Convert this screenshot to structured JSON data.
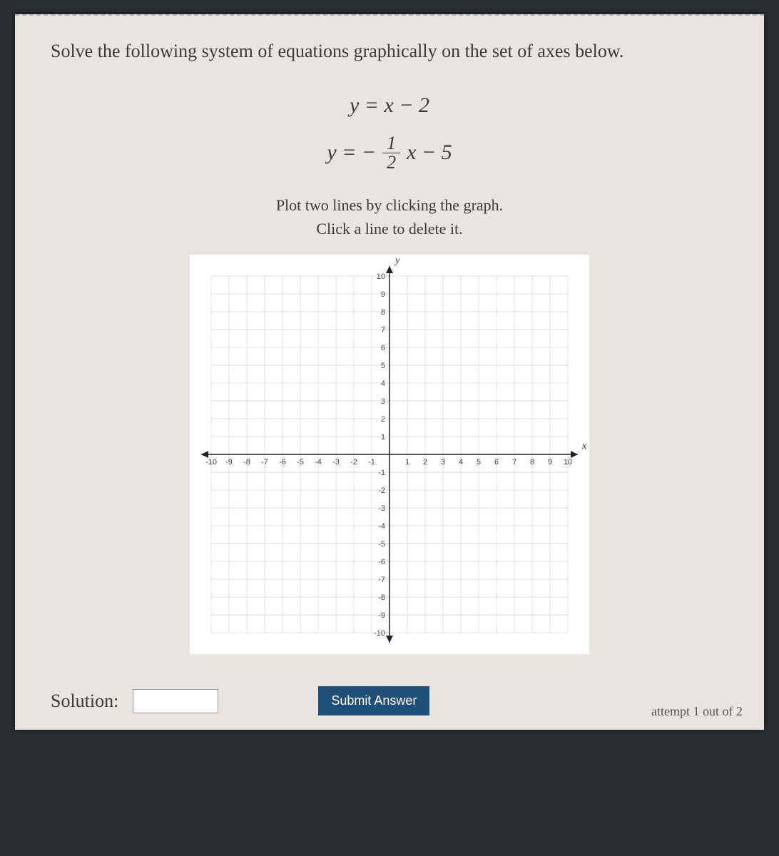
{
  "prompt": "Solve the following system of equations graphically on the set of axes below.",
  "eq1_text": "y = x − 2",
  "eq2_prefix": "y = −",
  "eq2_num": "1",
  "eq2_den": "2",
  "eq2_suffix": "x − 5",
  "instruction_line1": "Plot two lines by clicking the graph.",
  "instruction_line2": "Click a line to delete it.",
  "solution_label": "Solution:",
  "solution_value": "",
  "submit_label": "Submit Answer",
  "attempt_text": "attempt 1 out of 2",
  "chart_data": {
    "type": "line",
    "title": "",
    "xlabel": "x",
    "ylabel": "y",
    "xlim": [
      -10,
      10
    ],
    "ylim": [
      -10,
      10
    ],
    "x_ticks": [
      -10,
      -9,
      -8,
      -7,
      -6,
      -5,
      -4,
      -3,
      -2,
      -1,
      1,
      2,
      3,
      4,
      5,
      6,
      7,
      8,
      9,
      10
    ],
    "y_ticks": [
      -10,
      -9,
      -8,
      -7,
      -6,
      -5,
      -4,
      -3,
      -2,
      -1,
      1,
      2,
      3,
      4,
      5,
      6,
      7,
      8,
      9,
      10
    ],
    "grid": true,
    "series": []
  }
}
